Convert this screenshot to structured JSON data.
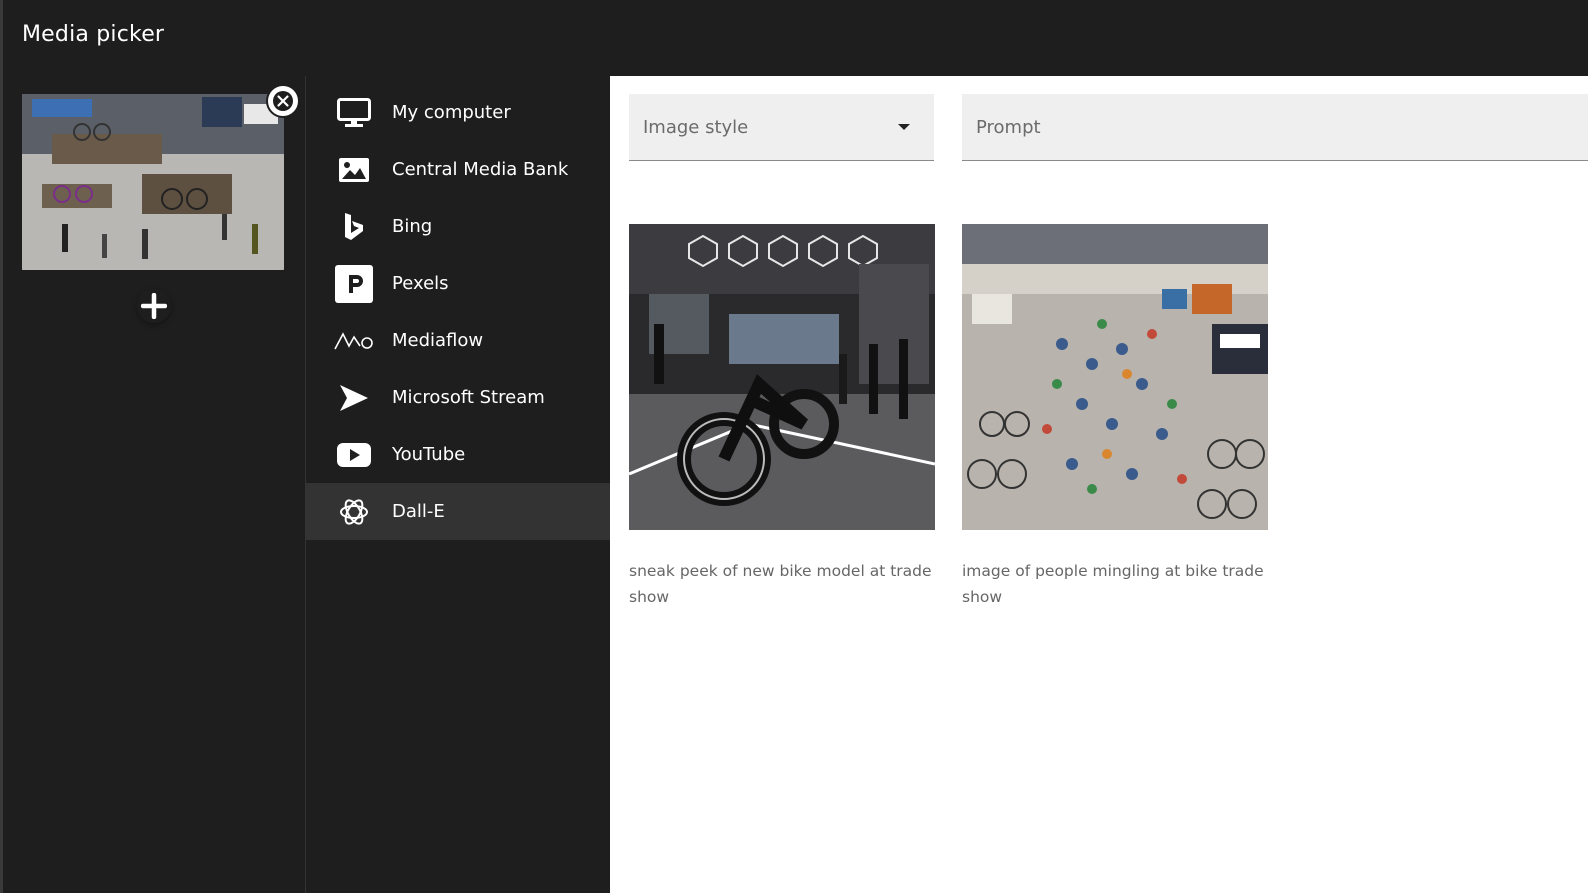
{
  "dialog": {
    "title": "Media picker"
  },
  "selected": {
    "thumbnail_alt": "bike trade show hall",
    "remove_icon": "close-icon",
    "add_icon": "plus-icon"
  },
  "sources": {
    "items": [
      {
        "label": "My computer",
        "icon": "monitor-icon",
        "active": false
      },
      {
        "label": "Central Media Bank",
        "icon": "image-icon",
        "active": false
      },
      {
        "label": "Bing",
        "icon": "bing-icon",
        "active": false
      },
      {
        "label": "Pexels",
        "icon": "pexels-icon",
        "active": false
      },
      {
        "label": "Mediaflow",
        "icon": "mediaflow-icon",
        "active": false
      },
      {
        "label": "Microsoft Stream",
        "icon": "stream-icon",
        "active": false
      },
      {
        "label": "YouTube",
        "icon": "youtube-icon",
        "active": false
      },
      {
        "label": "Dall-E",
        "icon": "openai-icon",
        "active": true
      }
    ]
  },
  "generator": {
    "style_placeholder": "Image style",
    "prompt_placeholder": "Prompt"
  },
  "results": [
    {
      "caption": "sneak peek of new bike model at trade show"
    },
    {
      "caption": "image of people mingling at bike trade show"
    }
  ],
  "colors": {
    "background": "#1e1e1e",
    "active_item": "#333333",
    "panel": "#ffffff",
    "field": "#efefef"
  }
}
